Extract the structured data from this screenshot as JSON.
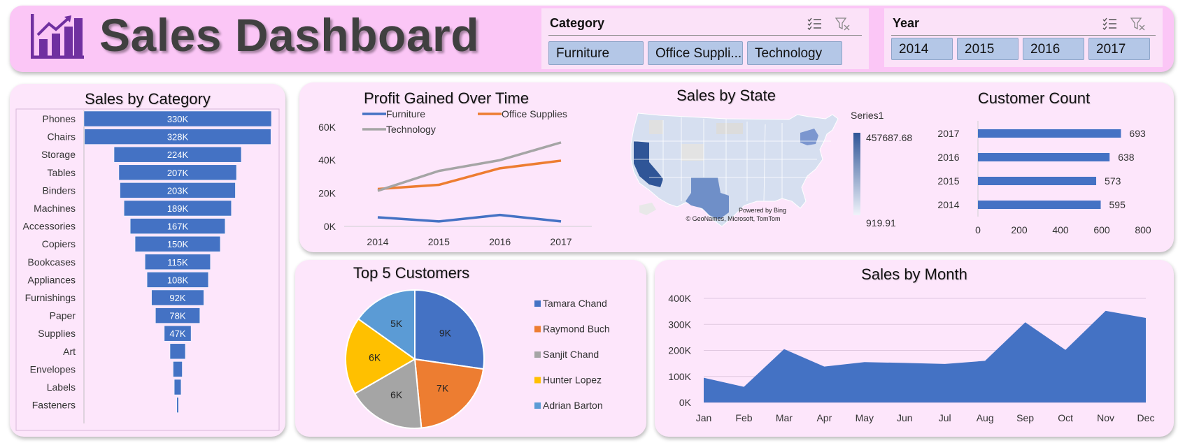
{
  "header": {
    "title": "Sales Dashboard"
  },
  "slicers": {
    "category": {
      "label": "Category",
      "items": [
        "Furniture",
        "Office Suppli...",
        "Technology"
      ]
    },
    "year": {
      "label": "Year",
      "items": [
        "2014",
        "2015",
        "2016",
        "2017"
      ]
    }
  },
  "colors": {
    "bar": "#4472c4",
    "furniture": "#4472c4",
    "office": "#ed7d31",
    "technology": "#a5a5a5",
    "yellow": "#ffc000",
    "lightblue": "#5b9bd5",
    "panel": "#fde6fb",
    "header": "#fbc6f6"
  },
  "map": {
    "title": "Sales by State",
    "legend_title": "Series1",
    "max_label": "457687.68",
    "min_label": "919.91",
    "credit1": "Powered by Bing",
    "credit2": "© GeoNames, Microsoft, TomTom"
  },
  "chart_data": [
    {
      "id": "sales_by_category",
      "type": "bar",
      "orientation": "horizontal-funnel",
      "title": "Sales by Category",
      "categories": [
        "Phones",
        "Chairs",
        "Storage",
        "Tables",
        "Binders",
        "Machines",
        "Accessories",
        "Copiers",
        "Bookcases",
        "Appliances",
        "Furnishings",
        "Paper",
        "Supplies",
        "Art",
        "Envelopes",
        "Labels",
        "Fasteners"
      ],
      "values": [
        330,
        328,
        224,
        207,
        203,
        189,
        167,
        150,
        115,
        108,
        92,
        78,
        47,
        27,
        16,
        12,
        3
      ],
      "data_labels": [
        "330K",
        "328K",
        "224K",
        "207K",
        "203K",
        "189K",
        "167K",
        "150K",
        "115K",
        "108K",
        "92K",
        "78K",
        "47K",
        "",
        "",
        "",
        ""
      ]
    },
    {
      "id": "profit_over_time",
      "type": "line",
      "title": "Profit Gained Over Time",
      "x": [
        "2014",
        "2015",
        "2016",
        "2017"
      ],
      "yticks": [
        "0K",
        "20K",
        "40K",
        "60K"
      ],
      "ylim": [
        0,
        65
      ],
      "series": [
        {
          "name": "Furniture",
          "values": [
            5.5,
            3.0,
            6.9,
            3.0
          ]
        },
        {
          "name": "Office Supplies",
          "values": [
            22.6,
            25.1,
            35.1,
            39.7
          ]
        },
        {
          "name": "Technology",
          "values": [
            21.5,
            33.5,
            40.0,
            50.7
          ]
        }
      ]
    },
    {
      "id": "customer_count",
      "type": "bar",
      "orientation": "horizontal",
      "title": "Customer Count",
      "categories": [
        "2017",
        "2016",
        "2015",
        "2014"
      ],
      "values": [
        693,
        638,
        573,
        595
      ],
      "xlim": [
        0,
        800
      ],
      "xticks": [
        "0",
        "200",
        "400",
        "600",
        "800"
      ]
    },
    {
      "id": "top5_customers",
      "type": "pie",
      "title": "Top 5 Customers",
      "labels": [
        "Tamara Chand",
        "Raymond Buch",
        "Sanjit Chand",
        "Hunter Lopez",
        "Adrian Barton"
      ],
      "values": [
        9,
        7,
        6,
        6,
        5
      ],
      "data_labels": [
        "9K",
        "7K",
        "6K",
        "6K",
        "5K"
      ]
    },
    {
      "id": "sales_by_month",
      "type": "area",
      "title": "Sales by Month",
      "x": [
        "Jan",
        "Feb",
        "Mar",
        "Apr",
        "May",
        "Jun",
        "Jul",
        "Aug",
        "Sep",
        "Oct",
        "Nov",
        "Dec"
      ],
      "values": [
        95,
        60,
        205,
        138,
        155,
        152,
        148,
        160,
        308,
        202,
        352,
        325
      ],
      "yticks": [
        "0K",
        "100K",
        "200K",
        "300K",
        "400K"
      ],
      "ylim": [
        0,
        400
      ]
    }
  ]
}
